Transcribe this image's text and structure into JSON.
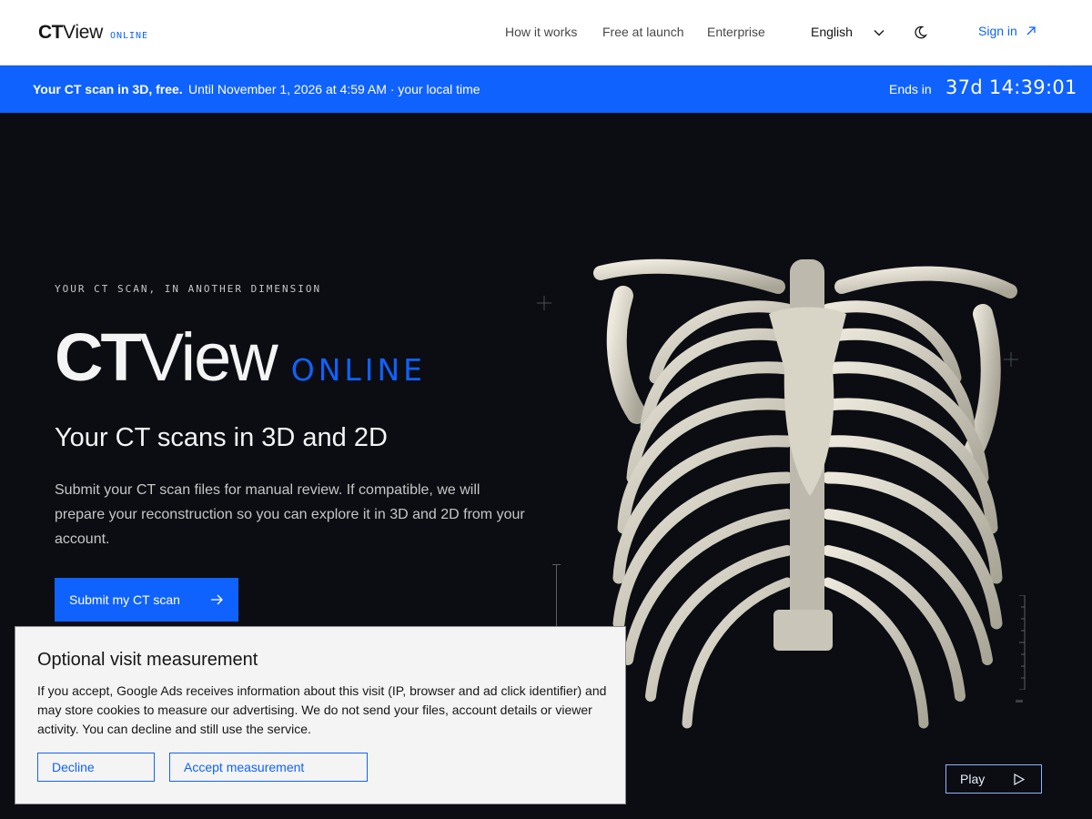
{
  "header": {
    "logo": {
      "ct": "CT",
      "view": "View",
      "online": "ONLINE"
    },
    "nav": [
      {
        "label": "How it works"
      },
      {
        "label": "Free at launch"
      },
      {
        "label": "Enterprise"
      }
    ],
    "language": "English",
    "signin": "Sign in",
    "icons": {
      "language": "chevron-down-icon",
      "theme": "moon-icon",
      "signin": "arrow-up-right-icon"
    }
  },
  "banner": {
    "strong": "Your CT scan in 3D, free.",
    "text": "Until November 1, 2026 at 4:59 AM · your local time",
    "ends_label": "Ends in",
    "countdown": "37d 14:39:01"
  },
  "hero": {
    "eyebrow": "YOUR CT SCAN, IN ANOTHER DIMENSION",
    "title_ct": "CT",
    "title_view": "View",
    "title_online": "ONLINE",
    "subtitle": "Your CT scans in 3D and 2D",
    "description": "Submit your CT scan files for manual review. If compatible, we will prepare your reconstruction so you can explore it in 3D and 2D from your account.",
    "cta": "Submit my CT scan"
  },
  "viewer": {
    "play": "Play"
  },
  "cookie": {
    "title": "Optional visit measurement",
    "text": "If you accept, Google Ads receives information about this visit (IP, browser and ad click identifier) and may store cookies to measure our advertising. We do not send your files, account details or viewer activity. You can decline and still use the service.",
    "decline": "Decline",
    "accept": "Accept measurement"
  },
  "colors": {
    "brand": "#0f62fe",
    "hero_bg": "#0b0d12",
    "bone": "#d8d4c6"
  }
}
